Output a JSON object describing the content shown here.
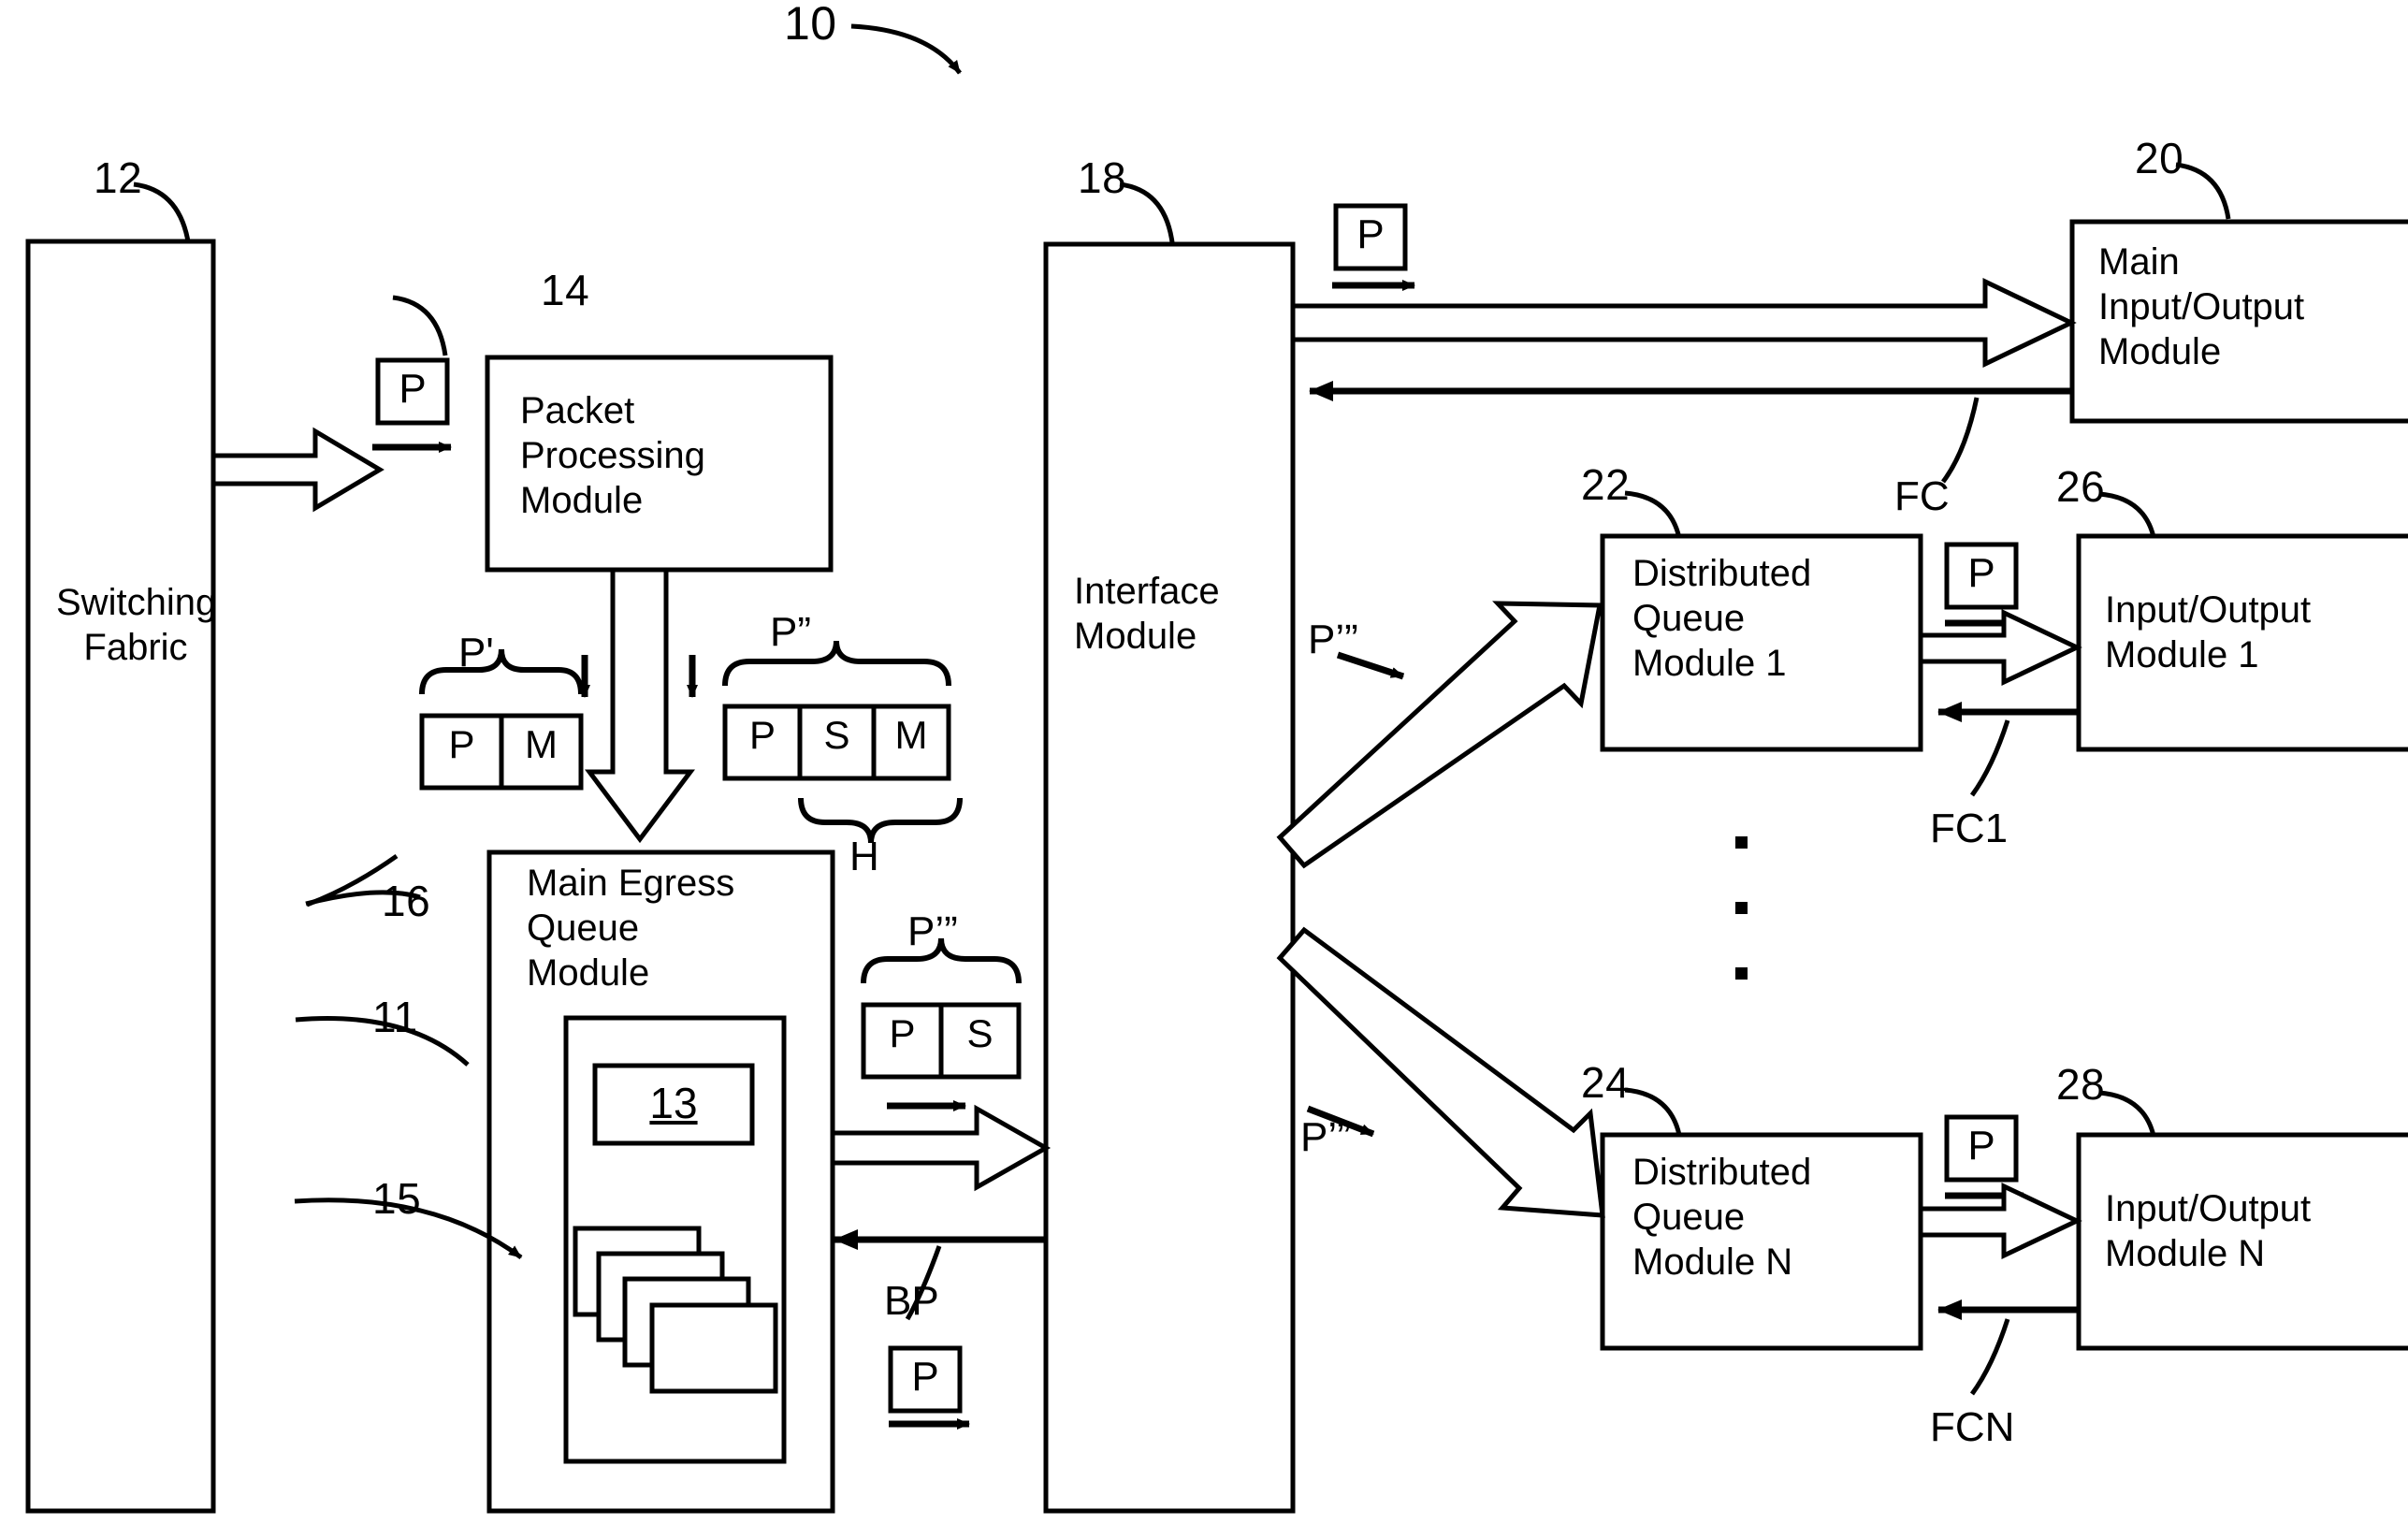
{
  "figure": {
    "reference_number": "10",
    "title_text": ""
  },
  "reference_numerals": {
    "fabric": "12",
    "packet_processing": "14",
    "main_egress_queue": "16",
    "inner_queue_container": "11",
    "queue_13": "13",
    "stacked_packets": "15",
    "interface_module": "18",
    "main_io_module": "20",
    "distributed_queue_1": "22",
    "distributed_queue_n": "24",
    "io_module_1": "26",
    "io_module_n": "28"
  },
  "blocks": {
    "switching_fabric": "Switching\nFabric",
    "packet_processing_module": "Packet\nProcessing\nModule",
    "main_egress_queue_module": "Main Egress\nQueue\nModule",
    "interface_module": "Interface\nModule",
    "main_io_module": "Main\nInput/Output\nModule",
    "distributed_queue_module_1": "Distributed\nQueue\nModule 1",
    "distributed_queue_module_n": "Distributed\nQueue\nModule N",
    "io_module_1": "Input/Output\nModule 1",
    "io_module_n": "Input/Output\nModule N",
    "inner_queue_label": "13"
  },
  "packet_labels": {
    "p_fabric_in": "P",
    "p_iface_to_main_io": "P",
    "p_dqm1_to_io1": "P",
    "p_dqmn_to_ion": "P",
    "p_bottom_egress": "P",
    "p_prime": "P'",
    "p_double_prime": "P”",
    "p_triple_prime_egress": "P’”",
    "p_triple_prime_dqm1": "P’”",
    "p_triple_prime_dqmn": "P’”",
    "header_brace": "H",
    "backpressure": "BP"
  },
  "flow_control_labels": {
    "fc_main": "FC",
    "fc_module_1": "FC1",
    "fc_module_n": "FCN"
  },
  "packet_cells": {
    "p_prime_cells": [
      "P",
      "M"
    ],
    "p_double_prime_cells": [
      "P",
      "S",
      "M"
    ],
    "p_triple_prime_cells": [
      "P",
      "S"
    ]
  },
  "ellipsis": {
    "dot_count": 3
  }
}
